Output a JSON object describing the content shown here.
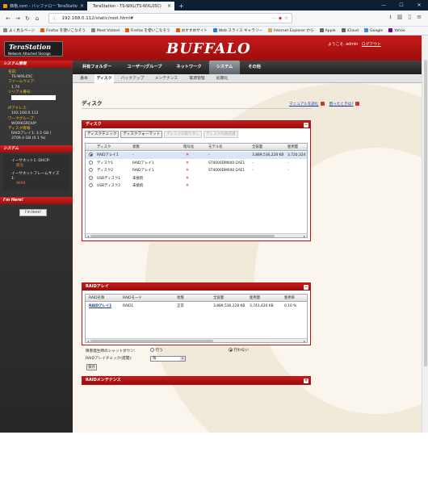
{
  "browser": {
    "tabs": [
      {
        "label": "価格.com - バッファロー TeraStation",
        "active": false
      },
      {
        "label": "TeraStation - TS-WXL(TS-WXL05C)",
        "active": true
      }
    ],
    "url": "192.168.0.112/static/root.html#",
    "url_more": "···",
    "bookmarks": [
      {
        "label": "よく見るページ",
        "icon": "gear-icon",
        "color": "#888"
      },
      {
        "label": "Firefox を使いこなそう",
        "icon": "firefox-icon",
        "color": "#e66000"
      },
      {
        "label": "Most Visited",
        "icon": "gear-icon",
        "color": "#888"
      },
      {
        "label": "Firefox を使いこなそう",
        "icon": "firefox-icon",
        "color": "#e66000"
      },
      {
        "label": "おすすめサイト",
        "icon": "firefox-icon",
        "color": "#e66000"
      },
      {
        "label": "Web スライス ギャラリー",
        "icon": "ie-icon",
        "color": "#2b7ad6"
      },
      {
        "label": "Internet Explorer から",
        "icon": "folder-icon",
        "color": "#d8b04c"
      },
      {
        "label": "Apple",
        "icon": "apple-icon",
        "color": "#666"
      },
      {
        "label": "iCloud",
        "icon": "apple-icon",
        "color": "#666"
      },
      {
        "label": "Google",
        "icon": "google-icon",
        "color": "#4285f4"
      },
      {
        "label": "Yahoo",
        "icon": "yahoo-icon",
        "color": "#7b0099"
      }
    ]
  },
  "header": {
    "logo_title": "TeraStation",
    "logo_sub": "Network Attached Storage",
    "brand": "BUFFALO",
    "welcome": "ようこそ, admin",
    "logout": "ログアウト"
  },
  "sidebar": {
    "system_info_title": "システム情報",
    "info": [
      {
        "key": "名前:",
        "value": "TS-WXL05C"
      },
      {
        "key": "ファームウェア:",
        "value": "1.74"
      },
      {
        "key": "シリアル番号:",
        "value": ""
      },
      {
        "key": "IPアドレス:",
        "value": "192.168.0.112"
      },
      {
        "key": "ワークグループ:",
        "value": "WORKGROUP"
      },
      {
        "key": "ディスク情報:",
        "value": "RAIDアレイ1: 3.5 GB / 3709.4 GB (0.1 %)"
      }
    ],
    "system_title": "システム",
    "system": [
      {
        "key": "イーサネット1: DHCP:",
        "value": "無効"
      },
      {
        "key": "イーサネットフレームサイズ1:",
        "value": "9694"
      }
    ],
    "imhere_title": "I'm Here!",
    "imhere_button": "I'm Here!"
  },
  "menu": [
    "共有フォルダー",
    "ユーザー/グループ",
    "ネットワーク",
    "システム",
    "その他"
  ],
  "menu_selected": 3,
  "submenu": [
    "基本",
    "ディスク",
    "バックアップ",
    "メンテナンス",
    "電源管理",
    "初期化"
  ],
  "submenu_selected": 1,
  "page": {
    "title": "ディスク",
    "manual_link": "マニュアルを読む",
    "help_link": "困ったときは?"
  },
  "disk_panel": {
    "title": "ディスク",
    "buttons": [
      {
        "label": "ディスクチェック",
        "enabled": true
      },
      {
        "label": "ディスクフォーマット",
        "enabled": true
      },
      {
        "label": "ディスクの取り外し",
        "enabled": false
      },
      {
        "label": "ディスクの再認識",
        "enabled": false
      }
    ],
    "columns": [
      "ディスク",
      "状態",
      "暗号化",
      "モデル名",
      "全容量",
      "使用量"
    ],
    "rows": [
      {
        "selected": true,
        "disk": "RAIDアレイ1",
        "status": "-",
        "enc": true,
        "model": "-",
        "total": "3,889,536,228 KB",
        "used": "3,720,324 K"
      },
      {
        "selected": false,
        "disk": "ディスク1",
        "status": "RAIDアレイ1",
        "enc": true,
        "model": "ST4000DM000-2AE1",
        "total": "-",
        "used": "-"
      },
      {
        "selected": false,
        "disk": "ディスク2",
        "status": "RAIDアレイ1",
        "enc": true,
        "model": "ST4000DM000-2AE1",
        "total": "-",
        "used": "-"
      },
      {
        "selected": false,
        "disk": "USBディスク1",
        "status": "未接続",
        "enc": true,
        "model": "",
        "total": "",
        "used": ""
      },
      {
        "selected": false,
        "disk": "USBディスク2",
        "status": "未接続",
        "enc": true,
        "model": "",
        "total": "",
        "used": ""
      }
    ]
  },
  "raid_panel": {
    "title": "RAIDアレイ",
    "columns": [
      "RAID名称",
      "RAIDモード",
      "状態",
      "全容量",
      "使用量",
      "使用率"
    ],
    "rows": [
      {
        "name": "RAIDアレイ1",
        "mode": "RAID1",
        "status": "正常",
        "total": "3,889,536,228 KB",
        "used": "3,743,420 KB",
        "rate": "0.10 %"
      }
    ]
  },
  "settings": {
    "shutdown_label": "障害発生時のシャットダウン:",
    "opt_do": "行う",
    "opt_dont": "行わない",
    "selected": "dont",
    "check_label": "RAIDアレイチェック(週間):",
    "check_value": "毎",
    "save": "保存"
  },
  "raid_maint_panel": {
    "title": "RAIDメンテナンス"
  }
}
